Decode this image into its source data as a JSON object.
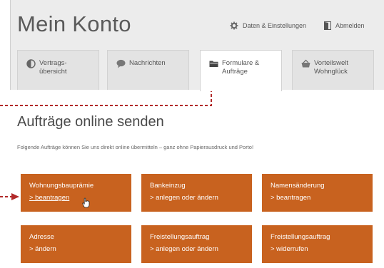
{
  "header": {
    "title": "Mein Konto",
    "settings_label": "Daten & Einstellungen",
    "logout_label": "Abmelden"
  },
  "tabs": [
    {
      "label": "Vertrags-\nübersicht",
      "icon": "half-circle-icon"
    },
    {
      "label": "Nachrichten",
      "icon": "speech-bubble-icon"
    },
    {
      "label": "Formulare &\nAufträge",
      "icon": "folder-icon",
      "active": true
    },
    {
      "label": "Vorteilswelt\nWohnglück",
      "icon": "basket-icon"
    }
  ],
  "main": {
    "title": "Aufträge online senden",
    "intro": "Folgende Aufträge können Sie uns direkt online übermitteln – ganz ohne Papierausdruck und Porto!"
  },
  "cards": [
    {
      "title": "Wohnungsbauprämie",
      "action": "> beantragen"
    },
    {
      "title": "Bankeinzug",
      "action": "> anlegen oder ändern"
    },
    {
      "title": "Namensänderung",
      "action": "> beantragen"
    },
    {
      "title": "Adresse",
      "action": "> ändern"
    },
    {
      "title": "Freistellungsauftrag",
      "action": "> anlegen oder ändern"
    },
    {
      "title": "Freistellungsauftrag",
      "action": "> widerrufen"
    }
  ],
  "colors": {
    "accent": "#c8621f",
    "annotation": "#b22a2a",
    "background": "#ececec"
  }
}
